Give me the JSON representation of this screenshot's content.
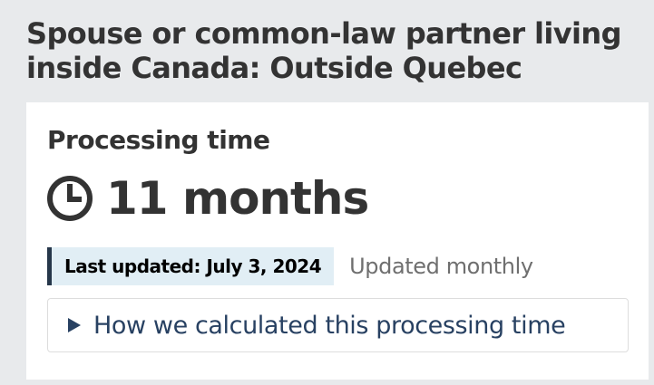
{
  "page": {
    "heading": "Spouse or common-law partner living inside Canada: Outside Quebec"
  },
  "card": {
    "title": "Processing time",
    "time_icon": "clock-icon",
    "time_value": "11 months",
    "last_updated": "Last updated: July 3, 2024",
    "update_frequency": "Updated monthly",
    "details_icon": "triangle-right-icon",
    "details_label": "How we calculated this processing time"
  },
  "colors": {
    "background": "#e8eaec",
    "card_background": "#ffffff",
    "text": "#333333",
    "link": "#284162",
    "updated_background": "#e1eef5",
    "updated_border": "#26374a",
    "muted_text": "#6f6f6f"
  }
}
